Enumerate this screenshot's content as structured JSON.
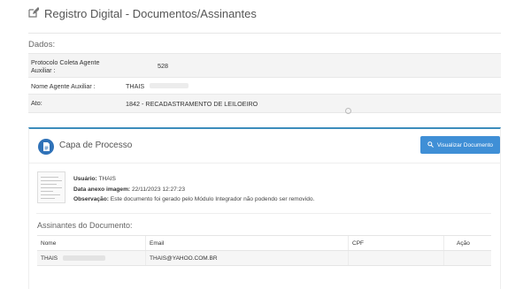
{
  "header": {
    "title": "Registro Digital - Documentos/Assinantes",
    "icon": "edit-icon"
  },
  "dados": {
    "label": "Dados:",
    "rows": [
      {
        "key": "Protocolo Coleta Agente Auxiliar :",
        "value": "528"
      },
      {
        "key": "Nome Agente Auxiliar :",
        "value": "THAIS"
      },
      {
        "key": "Ato:",
        "value": "1842 - RECADASTRAMENTO DE LEILOEIRO"
      }
    ]
  },
  "panel": {
    "title": "Capa de Processo",
    "icon": "document-icon",
    "view_button": "Visualizar Documento",
    "usuario_label": "Usuário:",
    "usuario_value": "THAIS",
    "data_label": "Data anexo imagem:",
    "data_value": "22/11/2023 12:27:23",
    "obs_label": "Observação:",
    "obs_value": "Este documento foi gerado pelo Módulo Integrador não podendo ser removido."
  },
  "assinantes": {
    "title": "Assinantes do Documento:",
    "columns": [
      "Nome",
      "Email",
      "CPF",
      "Ação"
    ],
    "rows": [
      {
        "nome": "THAIS",
        "email": "THAIS@YAHOO.COM.BR",
        "cpf": "",
        "acao": ""
      }
    ]
  },
  "colors": {
    "accent": "#3c8dbc",
    "button": "#3f8fd6"
  }
}
